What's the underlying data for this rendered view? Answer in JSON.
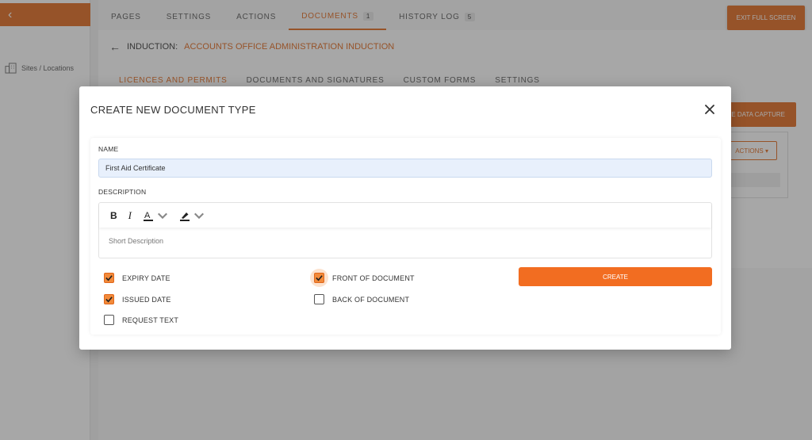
{
  "sidebar": {
    "toggle_glyph": "‹",
    "items": [
      {
        "label": "Sites / Locations",
        "icon": "building-icon"
      }
    ]
  },
  "top_tabs": [
    {
      "label": "PAGES"
    },
    {
      "label": "SETTINGS"
    },
    {
      "label": "ACTIONS"
    },
    {
      "label": "DOCUMENTS",
      "count": "1",
      "active": true
    },
    {
      "label": "HISTORY LOG",
      "count": "5"
    }
  ],
  "exit_button": "EXIT FULL SCREEN",
  "induction": {
    "label": "INDUCTION:",
    "name": "ACCOUNTS OFFICE ADMINISTRATION INDUCTION"
  },
  "sub_tabs": [
    {
      "label": "LICENCES AND PERMITS",
      "active": true
    },
    {
      "label": "DOCUMENTS AND SIGNATURES"
    },
    {
      "label": "CUSTOM FORMS"
    },
    {
      "label": "SETTINGS"
    }
  ],
  "data_capture_button": "E DATA CAPTURE",
  "actions_button": "ACTIONS ▾",
  "modal": {
    "title": "CREATE NEW DOCUMENT TYPE",
    "name_label": "NAME",
    "name_value": "First Aid Certificate",
    "description_label": "DESCRIPTION",
    "description_placeholder": "Short Description",
    "toolbar": {
      "bold": "B",
      "italic": "I",
      "font_color": "A"
    },
    "checkboxes": [
      {
        "label": "EXPIRY DATE",
        "checked": true
      },
      {
        "label": "ISSUED DATE",
        "checked": true
      },
      {
        "label": "REQUEST TEXT",
        "checked": false
      },
      {
        "label": "FRONT OF DOCUMENT",
        "checked": true
      },
      {
        "label": "BACK OF DOCUMENT",
        "checked": false
      }
    ],
    "create_button": "CREATE"
  },
  "colors": {
    "accent": "#e0661a",
    "button": "#f26d21",
    "input_bg": "#e8f0fc"
  }
}
